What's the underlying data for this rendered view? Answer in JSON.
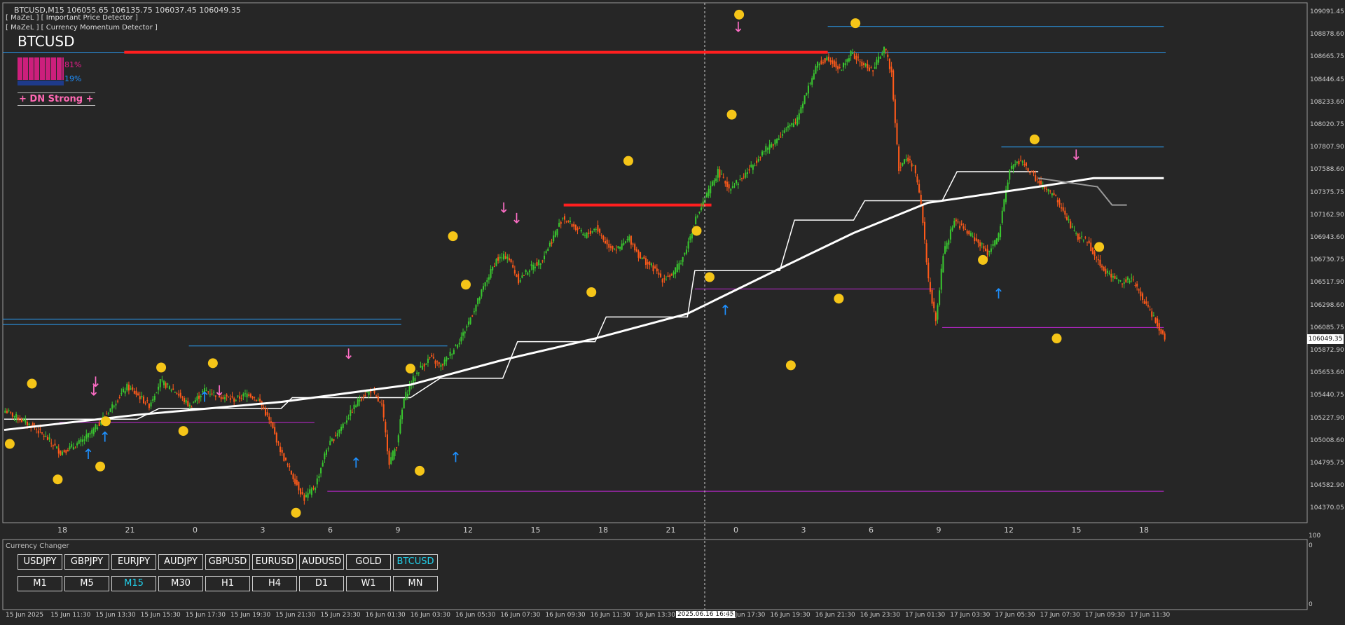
{
  "header": {
    "title": "BTCUSD,M15  106055.65 106135.75 106037.45 106049.35",
    "indicator_1": "[ MaZeL ] [ Important Price Detector ]",
    "indicator_2": "[ MaZeL ] [ Currency Momentum Detector ]"
  },
  "momentum_panel": {
    "symbol": "BTCUSD",
    "down_pct": "81%",
    "up_pct": "19%",
    "signal": "+ DN Strong +",
    "down_color": "#e91e8c",
    "up_color": "#1e90ff"
  },
  "current_price": "106049.35",
  "price_axis": {
    "labels": [
      "109091.45",
      "108878.60",
      "108665.75",
      "108446.45",
      "108233.60",
      "108020.75",
      "107807.90",
      "107588.60",
      "107375.75",
      "107162.90",
      "106943.60",
      "106730.75",
      "106517.90",
      "106298.60",
      "106085.75",
      "105872.90",
      "105653.60",
      "105440.75",
      "105227.90",
      "105008.60",
      "104795.75",
      "104582.90",
      "104370.05"
    ],
    "min": 104370.05,
    "max": 109091.45
  },
  "hour_axis": [
    "18",
    "21",
    "0",
    "3",
    "6",
    "9",
    "12",
    "15",
    "18",
    "21",
    "0",
    "3",
    "6",
    "9",
    "12",
    "15",
    "18"
  ],
  "sub_axis": {
    "top": "100",
    "bottom": "0",
    "right_top": "0",
    "right_bottom": "0"
  },
  "time_axis": [
    "15 Jun 2025",
    "15 Jun 11:30",
    "15 Jun 13:30",
    "15 Jun 15:30",
    "15 Jun 17:30",
    "15 Jun 19:30",
    "15 Jun 21:30",
    "15 Jun 23:30",
    "16 Jun 01:30",
    "16 Jun 03:30",
    "16 Jun 05:30",
    "16 Jun 07:30",
    "16 Jun 09:30",
    "16 Jun 11:30",
    "16 Jun 13:30",
    "2025.06.16 16:45",
    "16 Jun 17:30",
    "16 Jun 19:30",
    "16 Jun 21:30",
    "16 Jun 23:30",
    "17 Jun 01:30",
    "17 Jun 03:30",
    "17 Jun 05:30",
    "17 Jun 07:30",
    "17 Jun 09:30",
    "17 Jun 11:30"
  ],
  "currency_changer": {
    "title": "Currency Changer",
    "symbols": [
      "USDJPY",
      "GBPJPY",
      "EURJPY",
      "AUDJPY",
      "GBPUSD",
      "EURUSD",
      "AUDUSD",
      "GOLD",
      "BTCUSD"
    ],
    "active_symbol": "BTCUSD",
    "timeframes": [
      "M1",
      "M5",
      "M15",
      "M30",
      "H1",
      "H4",
      "D1",
      "W1",
      "MN"
    ],
    "active_timeframe": "M15"
  },
  "colors": {
    "bull": "#39c72f",
    "bear": "#ff5a1a",
    "support": "#c026d3",
    "resistance": "#2a9df4",
    "strong_level": "#ff1f1f",
    "ma": "#ffffff"
  },
  "chart_data": {
    "type": "candlestick",
    "symbol": "BTCUSD",
    "timeframe": "M15",
    "ylim": [
      104370.05,
      109091.45
    ],
    "close_path": [
      [
        0,
        105380
      ],
      [
        8,
        105300
      ],
      [
        16,
        105220
      ],
      [
        24,
        105100
      ],
      [
        30,
        104990
      ],
      [
        36,
        105040
      ],
      [
        42,
        105100
      ],
      [
        48,
        105200
      ],
      [
        54,
        105330
      ],
      [
        60,
        105470
      ],
      [
        66,
        105600
      ],
      [
        72,
        105520
      ],
      [
        78,
        105430
      ],
      [
        84,
        105650
      ],
      [
        92,
        105560
      ],
      [
        100,
        105420
      ],
      [
        108,
        105570
      ],
      [
        116,
        105520
      ],
      [
        124,
        105480
      ],
      [
        132,
        105540
      ],
      [
        138,
        105460
      ],
      [
        144,
        105250
      ],
      [
        150,
        104970
      ],
      [
        156,
        104760
      ],
      [
        162,
        104560
      ],
      [
        168,
        104680
      ],
      [
        174,
        105020
      ],
      [
        180,
        105180
      ],
      [
        186,
        105330
      ],
      [
        192,
        105490
      ],
      [
        198,
        105570
      ],
      [
        204,
        105420
      ],
      [
        208,
        104900
      ],
      [
        212,
        105060
      ],
      [
        216,
        105490
      ],
      [
        220,
        105640
      ],
      [
        224,
        105760
      ],
      [
        230,
        105870
      ],
      [
        236,
        105790
      ],
      [
        242,
        105930
      ],
      [
        248,
        106090
      ],
      [
        254,
        106320
      ],
      [
        260,
        106560
      ],
      [
        266,
        106780
      ],
      [
        272,
        106820
      ],
      [
        278,
        106590
      ],
      [
        284,
        106700
      ],
      [
        290,
        106770
      ],
      [
        296,
        106960
      ],
      [
        302,
        107180
      ],
      [
        308,
        107090
      ],
      [
        314,
        107000
      ],
      [
        320,
        107080
      ],
      [
        326,
        106920
      ],
      [
        332,
        106880
      ],
      [
        338,
        106980
      ],
      [
        344,
        106800
      ],
      [
        350,
        106720
      ],
      [
        356,
        106600
      ],
      [
        362,
        106650
      ],
      [
        368,
        106840
      ],
      [
        374,
        107160
      ],
      [
        380,
        107380
      ],
      [
        386,
        107600
      ],
      [
        392,
        107450
      ],
      [
        398,
        107520
      ],
      [
        404,
        107640
      ],
      [
        410,
        107780
      ],
      [
        416,
        107870
      ],
      [
        422,
        107980
      ],
      [
        428,
        108060
      ],
      [
        434,
        108350
      ],
      [
        440,
        108600
      ],
      [
        446,
        108660
      ],
      [
        452,
        108540
      ],
      [
        458,
        108700
      ],
      [
        464,
        108600
      ],
      [
        470,
        108540
      ],
      [
        476,
        108760
      ],
      [
        480,
        108520
      ],
      [
        484,
        107630
      ],
      [
        488,
        107720
      ],
      [
        492,
        107660
      ],
      [
        496,
        107300
      ],
      [
        500,
        106600
      ],
      [
        504,
        106200
      ],
      [
        508,
        106830
      ],
      [
        514,
        107150
      ],
      [
        520,
        107050
      ],
      [
        526,
        106960
      ],
      [
        532,
        106850
      ],
      [
        538,
        107000
      ],
      [
        544,
        107630
      ],
      [
        550,
        107700
      ],
      [
        556,
        107580
      ],
      [
        562,
        107450
      ],
      [
        568,
        107380
      ],
      [
        574,
        107200
      ],
      [
        580,
        107000
      ],
      [
        586,
        106960
      ],
      [
        592,
        106760
      ],
      [
        598,
        106640
      ],
      [
        604,
        106580
      ],
      [
        610,
        106600
      ],
      [
        616,
        106420
      ],
      [
        622,
        106250
      ],
      [
        628,
        106049
      ]
    ],
    "ma_path": [
      [
        0,
        105200
      ],
      [
        72,
        105340
      ],
      [
        150,
        105460
      ],
      [
        220,
        105620
      ],
      [
        270,
        105850
      ],
      [
        320,
        106050
      ],
      [
        370,
        106280
      ],
      [
        420,
        106700
      ],
      [
        460,
        107030
      ],
      [
        500,
        107310
      ],
      [
        560,
        107460
      ],
      [
        590,
        107540
      ],
      [
        628,
        107540
      ]
    ],
    "levels": [
      {
        "kind": "support",
        "price": 104630,
        "from": 175,
        "to": 628
      },
      {
        "kind": "support",
        "price": 105270,
        "from": 30,
        "to": 168
      },
      {
        "kind": "support",
        "price": 106510,
        "from": 374,
        "to": 504
      },
      {
        "kind": "support",
        "price": 106152,
        "from": 508,
        "to": 628
      },
      {
        "kind": "resistance",
        "price": 108950,
        "from": 446,
        "to": 628
      },
      {
        "kind": "resistance",
        "price": 107830,
        "from": 540,
        "to": 628
      },
      {
        "kind": "resistance",
        "price": 108710,
        "from": 0,
        "to": 0
      },
      {
        "kind": "resistance",
        "price": 105980,
        "from": 100,
        "to": 240
      },
      {
        "kind": "strong",
        "price": 108710,
        "from": 65,
        "to": 446
      },
      {
        "kind": "strong",
        "price": 107290,
        "from": 303,
        "to": 383
      }
    ]
  }
}
